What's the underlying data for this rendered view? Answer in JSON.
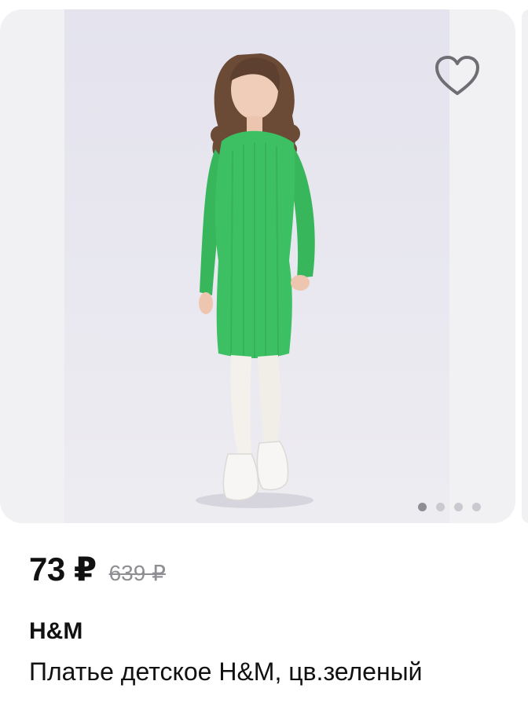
{
  "product": {
    "price": "73 ₽",
    "old_price": "639 ₽",
    "brand": "H&M",
    "title": "Платье детское H&M, цв.зеленый",
    "image": {
      "description_icon": "product-photo",
      "dress_color": "#3dbf63"
    },
    "favorite_icon": "heart-icon",
    "gallery": {
      "page_count": 4,
      "active_index": 0
    }
  },
  "colors": {
    "card_background": "#f1f1f4",
    "dot_active": "#8d8d93",
    "dot_inactive": "#c9c9cf",
    "old_price": "#8e8e93"
  }
}
